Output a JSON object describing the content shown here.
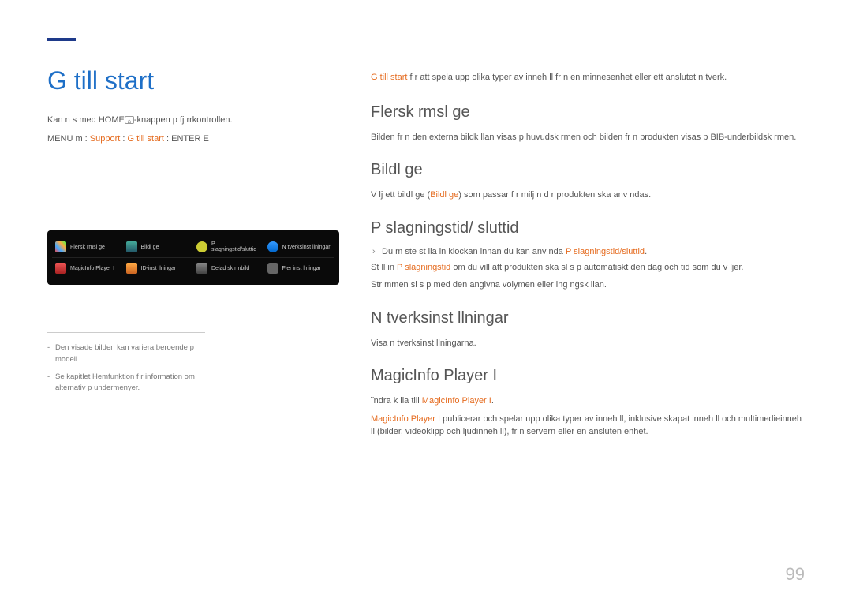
{
  "page_title": "G  till start",
  "page_number": "99",
  "left": {
    "note_home_pre": "Kan n s med HOME",
    "note_home_post": "-knappen p  fj rrkontrollen.",
    "breadcrumb": {
      "prefix": "MENU m  : ",
      "support": "Support",
      "sep1": "  :  ",
      "gotostart": "G  till start",
      "sep2": "  :  ",
      "enter": "ENTER E"
    },
    "menu": {
      "row1": [
        "Flersk rmsl ge",
        "Bildl ge",
        "P slagningstid/sluttid",
        "N tverksinst llningar"
      ],
      "row2": [
        "MagicInfo Player I",
        "ID-inst llningar",
        "Delad sk rmbild",
        "Fler inst llningar"
      ]
    },
    "footnote1": "Den visade bilden kan variera beroende p  modell.",
    "footnote2": "Se kapitlet Hemfunktion f r information om alternativ p  undermenyer."
  },
  "right": {
    "intro_hl": "G  till start",
    "intro_rest": " f r att spela upp olika typer av inneh ll fr n en minnesenhet eller ett anslutet n tverk.",
    "flerskarm": {
      "title": "Flersk rmsl ge",
      "body": "Bilden fr n den externa bildk llan visas p  huvudsk rmen och bilden fr n produkten visas p  BIB-underbildsk rmen."
    },
    "bildlage": {
      "title": "Bildl ge",
      "body_pre": "V lj ett bildl ge (",
      "body_hl": "Bildl ge",
      "body_post": ") som passar f r milj n d r produkten ska anv ndas."
    },
    "paslagning": {
      "title": "P slagningstid/ sluttid",
      "bullet_pre": "Du m ste st lla in klockan innan du kan anv nda ",
      "bullet_hl": "P slagningstid/sluttid",
      "bullet_post": ".",
      "body1_pre": "St ll in ",
      "body1_hl": "P slagningstid",
      "body1_post": " om du vill att produkten ska sl s p  automatiskt den dag och tid som du v ljer.",
      "body2": "Str mmen sl s p  med den angivna volymen eller ing ngsk llan."
    },
    "natverk": {
      "title": "N tverksinst llningar",
      "body": "Visa n tverksinst llningarna."
    },
    "magicinfo": {
      "title": "MagicInfo Player I",
      "body1_pre": "˜ndra k lla till ",
      "body1_hl": "MagicInfo Player I",
      "body1_post": ".",
      "body2_hl": "MagicInfo Player I",
      "body2_post": " publicerar och spelar upp olika typer av inneh ll, inklusive skapat inneh ll och multimedieinneh ll (bilder, videoklipp och ljudinneh ll), fr n servern eller en ansluten enhet."
    }
  }
}
